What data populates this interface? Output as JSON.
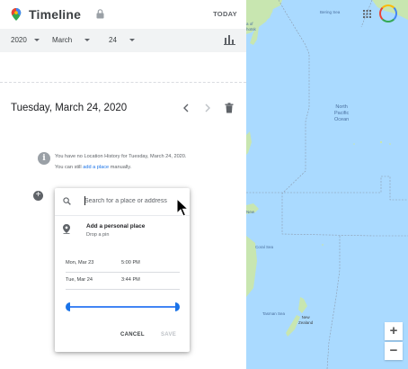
{
  "header": {
    "title": "Timeline",
    "today_label": "TODAY",
    "logo_icon": "google-maps-pin-icon",
    "lock_icon": "lock-icon"
  },
  "date_selector": {
    "year": "2020",
    "month": "March",
    "day": "24",
    "chart_icon": "bar-chart-icon"
  },
  "day_view": {
    "title": "Tuesday, March 24, 2020",
    "info_text_line1": "You have no Location History for Tuesday, March 24, 2020.",
    "info_text_prefix": "You can still",
    "info_link": "add a place",
    "info_text_suffix": "manually."
  },
  "add_place_panel": {
    "search_placeholder": "Search for a place or address",
    "personal_place_title": "Add a personal place",
    "personal_place_subtitle": "Drop a pin",
    "start": {
      "date": "Mon, Mar 23",
      "time": "5:00 PM"
    },
    "end": {
      "date": "Tue, Mar 24",
      "time": "3:44 PM"
    },
    "cancel_label": "CANCEL",
    "save_label": "SAVE"
  },
  "map": {
    "labels": {
      "bering_sea": "Bering Sea",
      "sea_of_okhotsk": "a of\nhotsk",
      "north_pacific": "North\nPacific\nOcean",
      "new": "New",
      "coral_sea": "Coral Sea",
      "tasman_sea": "Tasman Sea",
      "new_zealand": "New\nZealand"
    },
    "zoom_in": "+",
    "zoom_out": "−",
    "colors": {
      "water": "#aadaff",
      "land": "#c8e6b0",
      "accent": "#1a73e8"
    }
  }
}
